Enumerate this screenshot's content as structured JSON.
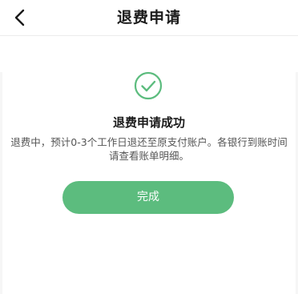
{
  "header": {
    "title": "退费申请",
    "back_icon": "chevron-left-icon"
  },
  "result": {
    "icon": "check-circle-icon",
    "icon_color": "#5cbc7e",
    "title": "退费申请成功",
    "description": "退费中，预计0-3个工作日退还至原支付账户。各银行到账时间请查看账单明细。"
  },
  "actions": {
    "done_label": "完成",
    "button_color": "#5cbc7e"
  }
}
